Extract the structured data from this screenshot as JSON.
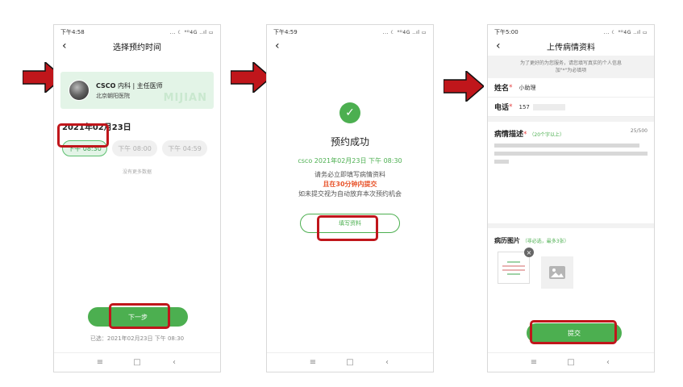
{
  "nav": {
    "menu": "≡",
    "home": "□",
    "back": "‹"
  },
  "phone1": {
    "status_time": "下午4:58",
    "status_icons": "... ☾ ᴴᴰ4G ..ıl ▭",
    "back": "‹",
    "title": "选择预约时间",
    "doctor": {
      "name": "CSCO",
      "dept": "内科 | 主任医师",
      "hospital": "北京朝阳医院",
      "watermark": "MIJIAN"
    },
    "date": "2021年02月23日",
    "slots": [
      "下午 08:30",
      "下午 08:00",
      "下午 04:59"
    ],
    "no_more": "没有更多数据",
    "next_button": "下一步",
    "selected": "已选：2021年02月23日 下午 08:30"
  },
  "phone2": {
    "status_time": "下午4:59",
    "status_icons": "... ☾ ᴴᴰ4G ..ıl ▭",
    "back": "‹",
    "success_icon": "✓",
    "success_title": "预约成功",
    "appointment": "csco  2021年02月23日 下午 08:30",
    "notice1": "请务必立即填写病情资料",
    "notice2": "且在30分钟内提交",
    "notice3": "如未提交视为自动放弃本次预约机会",
    "fill_button": "填写资料"
  },
  "phone3": {
    "status_time": "下午5:00",
    "status_icons": "... ☾ ᴴᴰ4G ..ıl ▭",
    "back": "‹",
    "title": "上传病情资料",
    "tip1": "为了更好的为您服务，请您填写真实的个人信息",
    "tip2": "加\"*\"为必填项",
    "name_label": "姓名",
    "name_value": "小助理",
    "phone_label": "电话",
    "phone_value": "157",
    "desc_label": "病情描述",
    "desc_hint": "（20个字以上）",
    "desc_count": "25/500",
    "photos_label": "病历图片",
    "photos_hint": "（非必选，最多3张）",
    "submit_button": "提交"
  },
  "colors": {
    "accent": "#4caf50",
    "highlight": "#c0161b",
    "alert": "#e8542b"
  }
}
